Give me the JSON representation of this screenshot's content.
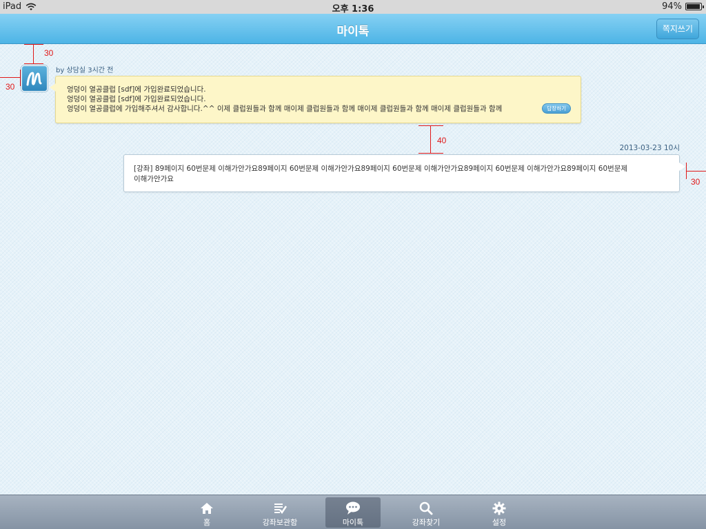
{
  "status_bar": {
    "device": "iPad",
    "time": "오후 1:36",
    "battery_text": "94%",
    "battery_level": 0.94
  },
  "nav": {
    "title": "마이톡",
    "compose_label": "쪽지쓰기"
  },
  "annotations": [
    "30",
    "30",
    "40",
    "30"
  ],
  "messages": [
    {
      "meta": "by 상담실 3시간 전",
      "lines": [
        "엉덩이 열공클럽 [sdf]에 가입완료되었습니다.",
        "엉덩이 열공클럽 [sdf]에 가입완료되었습니다.",
        "엉덩이 열공클럽에 가입해주셔서 감사합니다.^^ 이제 클럽원들과 함께 매이제 클럽원들과 함께 매이제 클럽원들과 함께 매이제 클럽원들과 함께"
      ],
      "reply_label": "답장하기"
    },
    {
      "timestamp": "2013-03-23 10시",
      "lines": [
        "[강좌] 89페이지 60번문제 이해가안가요89페이지 60번문제 이해가안가요89페이지 60번문제 이해가안가요89페이지 60번문제 이해가안가요89페이지 60번문제",
        "이해가안가요"
      ]
    }
  ],
  "tabs": [
    {
      "label": "홈",
      "icon": "home-icon",
      "active": false
    },
    {
      "label": "강좌보관함",
      "icon": "checklist-icon",
      "active": false
    },
    {
      "label": "마이톡",
      "icon": "chat-bubble-icon",
      "active": true
    },
    {
      "label": "강좌찾기",
      "icon": "search-icon",
      "active": false
    },
    {
      "label": "설정",
      "icon": "gear-icon",
      "active": false
    }
  ],
  "colors": {
    "accent": "#4db4e6",
    "incoming_bubble": "#fdf6c8",
    "annotation": "#e01818"
  }
}
